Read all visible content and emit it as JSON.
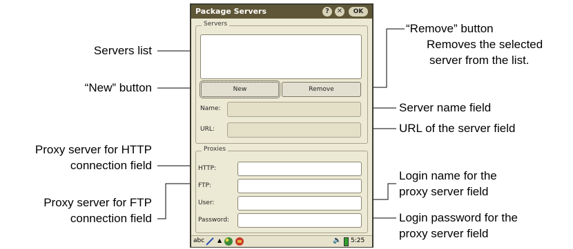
{
  "window": {
    "title": "Package Servers",
    "help_icon": "?",
    "close_icon": "✕",
    "ok_label": "OK"
  },
  "servers_group": {
    "legend": "Servers",
    "new_label": "New",
    "remove_label": "Remove",
    "name_label": "Name:",
    "url_label": "URL:"
  },
  "proxies_group": {
    "legend": "Proxies",
    "http_label": "HTTP:",
    "ftp_label": "FTP:",
    "user_label": "User:",
    "password_label": "Password:"
  },
  "statusbar": {
    "input_mode": "abc",
    "time": "5:25"
  },
  "callouts": {
    "servers_list": "Servers list",
    "new_button": "“New” button",
    "proxy_http_1": "Proxy server for HTTP",
    "proxy_http_2": "connection field",
    "proxy_ftp_1": "Proxy server for FTP",
    "proxy_ftp_2": "connection field",
    "remove_button": "“Remove” button",
    "remove_desc_1": "Removes the selected",
    "remove_desc_2": "server from the list.",
    "server_name": "Server name field",
    "server_url": "URL of the server field",
    "login_name_1": "Login name for the",
    "login_name_2": "proxy server field",
    "login_pass_1": "Login password for the",
    "login_pass_2": "proxy server field"
  }
}
